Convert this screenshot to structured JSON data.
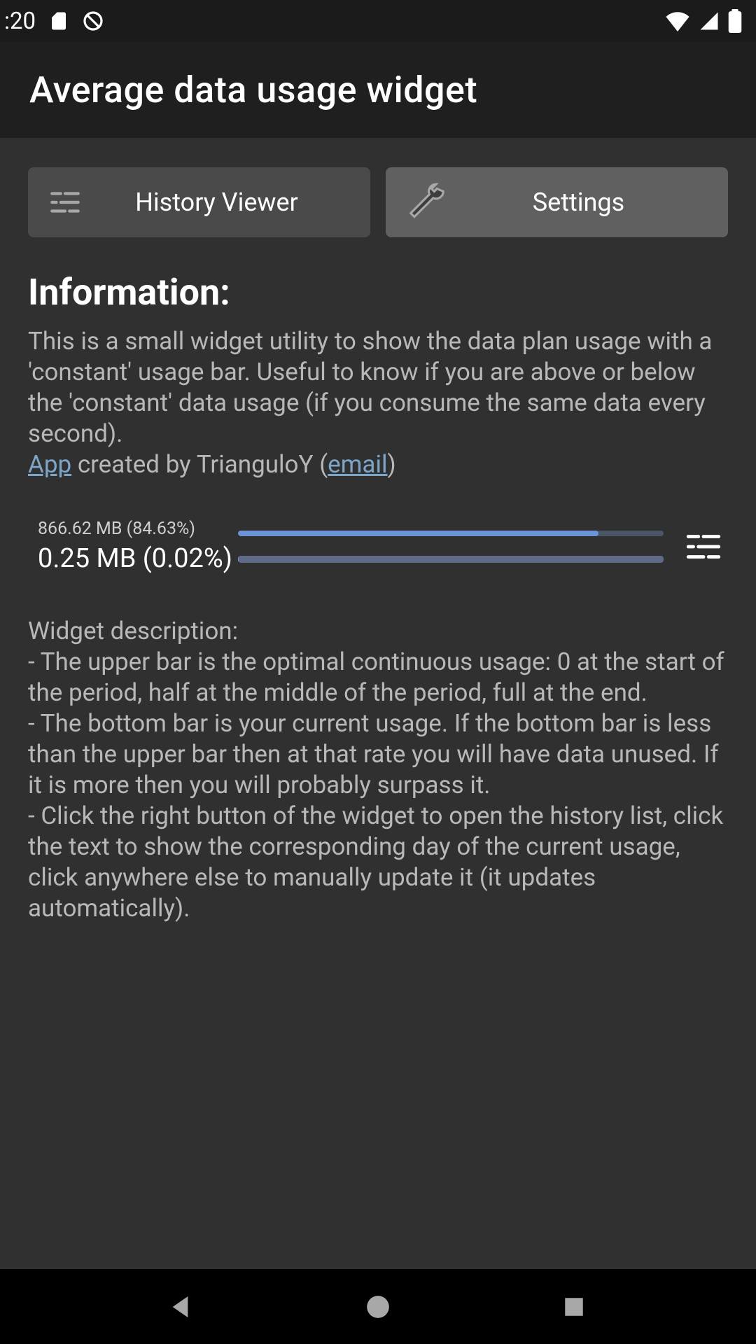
{
  "statusbar": {
    "time": ":20"
  },
  "appbar": {
    "title": "Average data usage widget"
  },
  "buttons": {
    "history": "History Viewer",
    "settings": "Settings"
  },
  "info": {
    "heading": "Information:",
    "body_pre": "This is a small widget utility to show the data plan usage with a 'constant' usage bar. Useful to know if you are above or below the 'constant' data usage (if you consume the same data every second).",
    "app_link": "App",
    "created_by_mid": " created by TrianguloY (",
    "email_link": "email",
    "created_by_post": ")"
  },
  "widget": {
    "line1": "866.62 MB (84.63%)",
    "line2": "0.25 MB (0.02%)"
  },
  "desc": {
    "heading": "Widget description:",
    "b1": "- The upper bar is the optimal continuous usage: 0 at the start of the period, half at the middle of the period, full at the end.",
    "b2": "- The bottom bar is your current usage. If the bottom bar is less than the upper bar then at that rate you will have data unused. If it is more then you will probably surpass it.",
    "b3": "- Click the right button of the widget to open the history list, click the text to show the corresponding day of the current usage, click anywhere else to manually update it (it updates automatically)."
  },
  "chart_data": {
    "type": "bar",
    "series": [
      {
        "name": "optimal continuous usage",
        "value_mb": 866.62,
        "percent": 84.63
      },
      {
        "name": "current usage",
        "value_mb": 0.25,
        "percent": 0.02
      }
    ],
    "xlabel": "",
    "ylabel": "",
    "ylim": [
      0,
      100
    ]
  }
}
